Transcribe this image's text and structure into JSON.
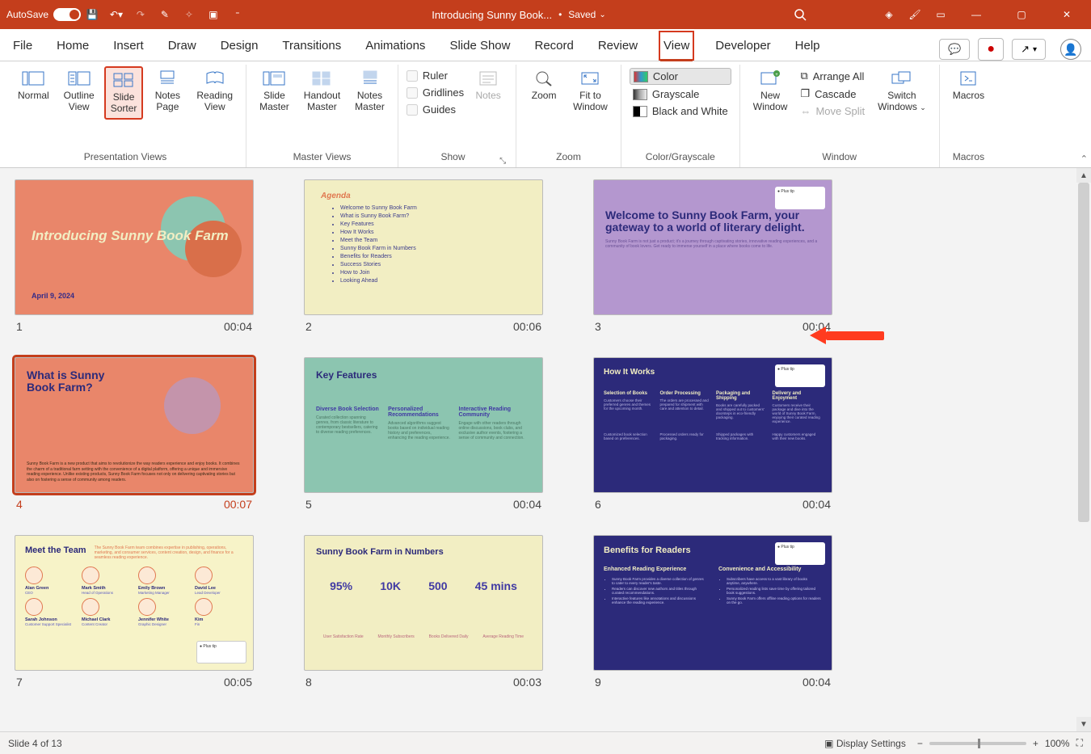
{
  "titlebar": {
    "autosave_label": "AutoSave",
    "autosave_state": "On",
    "doc_title": "Introducing Sunny Book...",
    "saved_label": "Saved"
  },
  "tabs": {
    "file": "File",
    "home": "Home",
    "insert": "Insert",
    "draw": "Draw",
    "design": "Design",
    "transitions": "Transitions",
    "animations": "Animations",
    "slideshow": "Slide Show",
    "record": "Record",
    "review": "Review",
    "view": "View",
    "developer": "Developer",
    "help": "Help"
  },
  "ribbon": {
    "presentation_views": {
      "label": "Presentation Views",
      "normal": "Normal",
      "outline": "Outline\nView",
      "sorter": "Slide\nSorter",
      "notes": "Notes\nPage",
      "reading": "Reading\nView"
    },
    "master_views": {
      "label": "Master Views",
      "slide": "Slide\nMaster",
      "handout": "Handout\nMaster",
      "notes": "Notes\nMaster"
    },
    "show": {
      "label": "Show",
      "ruler": "Ruler",
      "gridlines": "Gridlines",
      "guides": "Guides",
      "notes_btn": "Notes"
    },
    "zoom": {
      "label": "Zoom",
      "zoom_btn": "Zoom",
      "fit": "Fit to\nWindow"
    },
    "color": {
      "label": "Color/Grayscale",
      "color_opt": "Color",
      "grayscale_opt": "Grayscale",
      "bw_opt": "Black and White"
    },
    "window": {
      "label": "Window",
      "new": "New\nWindow",
      "arrange": "Arrange All",
      "cascade": "Cascade",
      "movesplit": "Move Split",
      "switch": "Switch\nWindows"
    },
    "macros": {
      "label": "Macros",
      "btn": "Macros"
    }
  },
  "slides": [
    {
      "num": "1",
      "time": "00:04",
      "title": "Introducing Sunny Book Farm",
      "sub": "April 9, 2024"
    },
    {
      "num": "2",
      "time": "00:06",
      "title": "Agenda",
      "items": [
        "Welcome to Sunny Book Farm",
        "What is Sunny Book Farm?",
        "Key Features",
        "How It Works",
        "Meet the Team",
        "Sunny Book Farm in Numbers",
        "Benefits for Readers",
        "Success Stories",
        "How to Join",
        "Looking Ahead"
      ]
    },
    {
      "num": "3",
      "time": "00:04",
      "title": "Welcome to Sunny Book Farm, your gateway to a world of literary delight.",
      "sub": "Sunny Book Farm is not just a product; it's a journey through captivating stories, innovative reading experiences, and a community of book lovers. Get ready to immerse yourself in a place where books come to life."
    },
    {
      "num": "4",
      "time": "00:07",
      "title": "What is Sunny Book Farm?",
      "para": "Sunny Book Farm is a new product that aims to revolutionize the way readers experience and enjoy books. It combines the charm of a traditional farm setting with the convenience of a digital platform, offering a unique and immersive reading experience. Unlike existing products, Sunny Book Farm focuses not only on delivering captivating stories but also on fostering a sense of community among readers."
    },
    {
      "num": "5",
      "time": "00:04",
      "title": "Key Features",
      "cols": [
        {
          "h": "Diverse Book Selection",
          "p": "Curated collection spanning genres, from classic literature to contemporary bestsellers, catering to diverse reading preferences."
        },
        {
          "h": "Personalized Recommendations",
          "p": "Advanced algorithms suggest books based on individual reading history and preferences, enhancing the reading experience."
        },
        {
          "h": "Interactive Reading Community",
          "p": "Engage with other readers through online discussions, book clubs, and exclusive author events, fostering a sense of community and connection."
        }
      ]
    },
    {
      "num": "6",
      "time": "00:04",
      "title": "How It Works",
      "steps": [
        {
          "h": "Selection of Books",
          "p": "Customers choose their preferred genres and themes for the upcoming month."
        },
        {
          "h": "Order Processing",
          "p": "The orders are processed and prepared for shipment with care and attention to detail."
        },
        {
          "h": "Packaging and Shipping",
          "p": "Books are carefully packed and shipped out to customers' doorsteps in eco-friendly packaging."
        },
        {
          "h": "Delivery and Enjoyment",
          "p": "Customers receive their package and dive into the world of Sunny Book Farm, enjoying their curated reading experience."
        }
      ],
      "steps2": [
        {
          "p": "Customized book selection based on preferences."
        },
        {
          "p": "Processed orders ready for packaging."
        },
        {
          "p": "Shipped packages with tracking information."
        },
        {
          "p": "Happy customers engaged with their new books."
        }
      ]
    },
    {
      "num": "7",
      "time": "00:05",
      "title": "Meet the Team",
      "intro": "The Sunny Book Farm team combines expertise in publishing, operations, marketing, and consumer services, content creation, design, and finance for a seamless reading experience.",
      "people": [
        {
          "n": "Alan Green",
          "r": "CEO"
        },
        {
          "n": "Mark Smith",
          "r": "Head of Operations"
        },
        {
          "n": "Emily Brown",
          "r": "Marketing Manager"
        },
        {
          "n": "David Lee",
          "r": "Lead Developer"
        },
        {
          "n": "Sarah Johnson",
          "r": "Customer Support Specialist"
        },
        {
          "n": "Michael Clark",
          "r": "Content Creator"
        },
        {
          "n": "Jennifer White",
          "r": "Graphic Designer"
        },
        {
          "n": "Kim",
          "r": "Fin"
        }
      ]
    },
    {
      "num": "8",
      "time": "00:03",
      "title": "Sunny Book Farm in Numbers",
      "nums": [
        {
          "v": "95%",
          "l": "User Satisfaction Rate"
        },
        {
          "v": "10K",
          "l": "Monthly Subscribers"
        },
        {
          "v": "500",
          "l": "Books Delivered Daily"
        },
        {
          "v": "45 mins",
          "l": "Average Reading Time"
        }
      ]
    },
    {
      "num": "9",
      "time": "00:04",
      "title": "Benefits for Readers",
      "colA": {
        "h": "Enhanced Reading Experience",
        "items": [
          "Sunny Book Farm provides a diverse collection of genres to cater to every reader's taste.",
          "Readers can discover new authors and titles through curated recommendations.",
          "Interactive features like annotations and discussions enhance the reading experience."
        ]
      },
      "colB": {
        "h": "Convenience and Accessibility",
        "items": [
          "Subscribers have access to a vast library of books anytime, anywhere.",
          "Personalized reading lists save time by offering tailored book suggestions.",
          "Sunny Book Farm offers offline reading options for readers on the go."
        ]
      }
    }
  ],
  "status": {
    "slide_of": "Slide 4 of 13",
    "display_settings": "Display Settings",
    "zoom_pct": "100%"
  }
}
